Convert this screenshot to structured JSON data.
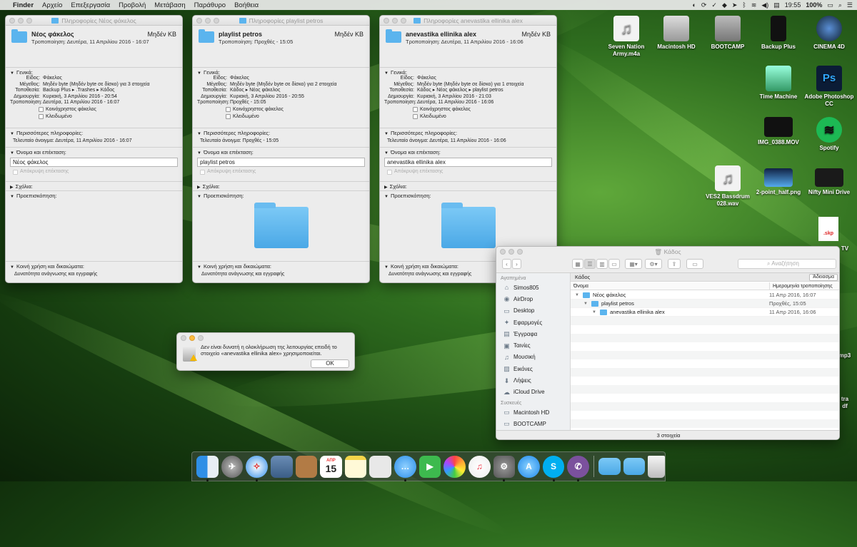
{
  "menubar": {
    "app": "Finder",
    "items": [
      "Αρχείο",
      "Επεξεργασία",
      "Προβολή",
      "Μετάβαση",
      "Παράθυρο",
      "Βοήθεια"
    ],
    "time": "19:55",
    "battery": "100%"
  },
  "info_windows": [
    {
      "title": "Πληροφορίες Νέος φάκελος",
      "name": "Νέος φάκελος",
      "size": "Μηδέν KB",
      "modified": "Τροποποίηση: Δευτέρα, 11 Απριλίου 2016 - 16:07",
      "general_label": "Γενικά:",
      "rows": [
        [
          "Είδος:",
          "Φάκελος"
        ],
        [
          "Μέγεθος:",
          "Μηδέν byte (Μηδέν byte σε δίσκο) για 3 στοιχεία"
        ],
        [
          "Τοποθεσία:",
          "Backup Plus ▸ .Trashes ▸ Κάδος"
        ],
        [
          "Δημιουργία:",
          "Κυριακή, 3 Απριλίου 2016 - 20:54"
        ],
        [
          "Τροποποίηση:",
          "Δευτέρα, 11 Απριλίου 2016 - 16:07"
        ]
      ],
      "shared": "Κοινόχρηστος φάκελος",
      "locked": "Κλειδωμένο",
      "more_label": "Περισσότερες πληροφορίες:",
      "last_opened": "Τελευταίο άνοιγμα: Δευτέρα, 11 Απριλίου 2016 - 16:07",
      "name_ext_label": "Όνομα και επέκταση:",
      "name_value": "Νέος φάκελος",
      "hide_ext": "Απόκρυψη επέκτασης",
      "comments_label": "Σχόλια:",
      "preview_label": "Προεπισκόπηση:",
      "sharing_label": "Κοινή χρήση και δικαιώματα:",
      "permission": "Δυνατότητα ανάγνωσης και εγγραφής",
      "show_preview": false
    },
    {
      "title": "Πληροφορίες playlist petros",
      "name": "playlist petros",
      "size": "Μηδέν KB",
      "modified": "Τροποποίηση: Προχθές - 15:05",
      "general_label": "Γενικά:",
      "rows": [
        [
          "Είδος:",
          "Φάκελος"
        ],
        [
          "Μέγεθος:",
          "Μηδέν byte (Μηδέν byte σε δίσκο) για 2 στοιχεία"
        ],
        [
          "Τοποθεσία:",
          "Κάδος ▸ Νέος φάκελος"
        ],
        [
          "Δημιουργία:",
          "Κυριακή, 3 Απριλίου 2016 - 20:55"
        ],
        [
          "Τροποποίηση:",
          "Προχθές - 15:05"
        ]
      ],
      "shared": "Κοινόχρηστος φάκελος",
      "locked": "Κλειδωμένο",
      "more_label": "Περισσότερες πληροφορίες:",
      "last_opened": "Τελευταίο άνοιγμα: Προχθές - 15:05",
      "name_ext_label": "Όνομα και επέκταση:",
      "name_value": "playlist petros",
      "hide_ext": "Απόκρυψη επέκτασης",
      "comments_label": "Σχόλια:",
      "preview_label": "Προεπισκόπηση:",
      "sharing_label": "Κοινή χρήση και δικαιώματα:",
      "permission": "Δυνατότητα ανάγνωσης και εγγραφής",
      "show_preview": true
    },
    {
      "title": "Πληροφορίες anevastika ellinika alex",
      "name": "anevastika ellinika alex",
      "size": "Μηδέν KB",
      "modified": "Τροποποίηση: Δευτέρα, 11 Απριλίου 2016 - 16:06",
      "general_label": "Γενικά:",
      "rows": [
        [
          "Είδος:",
          "Φάκελος"
        ],
        [
          "Μέγεθος:",
          "Μηδέν byte (Μηδέν byte σε δίσκο) για 1 στοιχεία"
        ],
        [
          "Τοποθεσία:",
          "Κάδος ▸ Νέος φάκελος ▸ playlist petros"
        ],
        [
          "Δημιουργία:",
          "Κυριακή, 3 Απριλίου 2016 - 21:03"
        ],
        [
          "Τροποποίηση:",
          "Δευτέρα, 11 Απριλίου 2016 - 16:06"
        ]
      ],
      "shared": "Κοινόχρηστος φάκελος",
      "locked": "Κλειδωμένο",
      "more_label": "Περισσότερες πληροφορίες:",
      "last_opened": "Τελευταίο άνοιγμα: Δευτέρα, 11 Απριλίου 2016 - 16:06",
      "name_ext_label": "Όνομα και επέκταση:",
      "name_value": "anevastika ellinika alex",
      "hide_ext": "Απόκρυψη επέκτασης",
      "comments_label": "Σχόλια:",
      "preview_label": "Προεπισκόπηση:",
      "sharing_label": "Κοινή χρήση και δικαιώματα:",
      "permission": "Δυνατότητα ανάγνωσης και εγγραφής",
      "show_preview": true
    }
  ],
  "alert": {
    "message": "Δεν είναι δυνατή η ολοκλήρωση της λειτουργίας επειδή το στοιχείο «anevastika ellinika alex» χρησιμοποιείται.",
    "ok": "OK"
  },
  "finder": {
    "title": "Κάδος",
    "search_placeholder": "Αναζήτηση",
    "path": "Κάδος",
    "empty_button": "Άδειασμα",
    "sidebar_favorites": "Αγαπημένα",
    "favorites": [
      "Simos805",
      "AirDrop",
      "Desktop",
      "Εφαρμογές",
      "Έγγραφα",
      "Ταινίες",
      "Μουσική",
      "Εικόνες",
      "Λήψεις",
      "iCloud Drive"
    ],
    "sidebar_devices": "Συσκευές",
    "devices": [
      "Macintosh HD",
      "BOOTCAMP"
    ],
    "col_name": "Όνομα",
    "col_date": "Ημερομηνία τροποποίησης",
    "rows": [
      {
        "name": "Νέος φάκελος",
        "date": "11 Απρ 2016, 16:07",
        "indent": 0
      },
      {
        "name": "playlist petros",
        "date": "Προχθές, 15:05",
        "indent": 1
      },
      {
        "name": "anevastika ellinika alex",
        "date": "11 Απρ 2016, 16:06",
        "indent": 2
      }
    ],
    "status": "3 στοιχεία"
  },
  "desktop": {
    "items": [
      "Seven Nation Army.m4a",
      "Macintosh HD",
      "BOOTCAMP",
      "Backup Plus",
      "CINEMA 4D",
      "Time Machine",
      "Adobe Photoshop CC",
      "IMG_0388.MOV",
      "Spotify",
      "VES2 Bassdrum 028.wav",
      "2-point_half.png",
      "Nifty Mini Drive"
    ],
    "partial": [
      "TV",
      "mp3",
      "tra",
      "df"
    ]
  },
  "dock": {
    "calendar_day": "15",
    "calendar_month": "ΑΠΡ"
  }
}
